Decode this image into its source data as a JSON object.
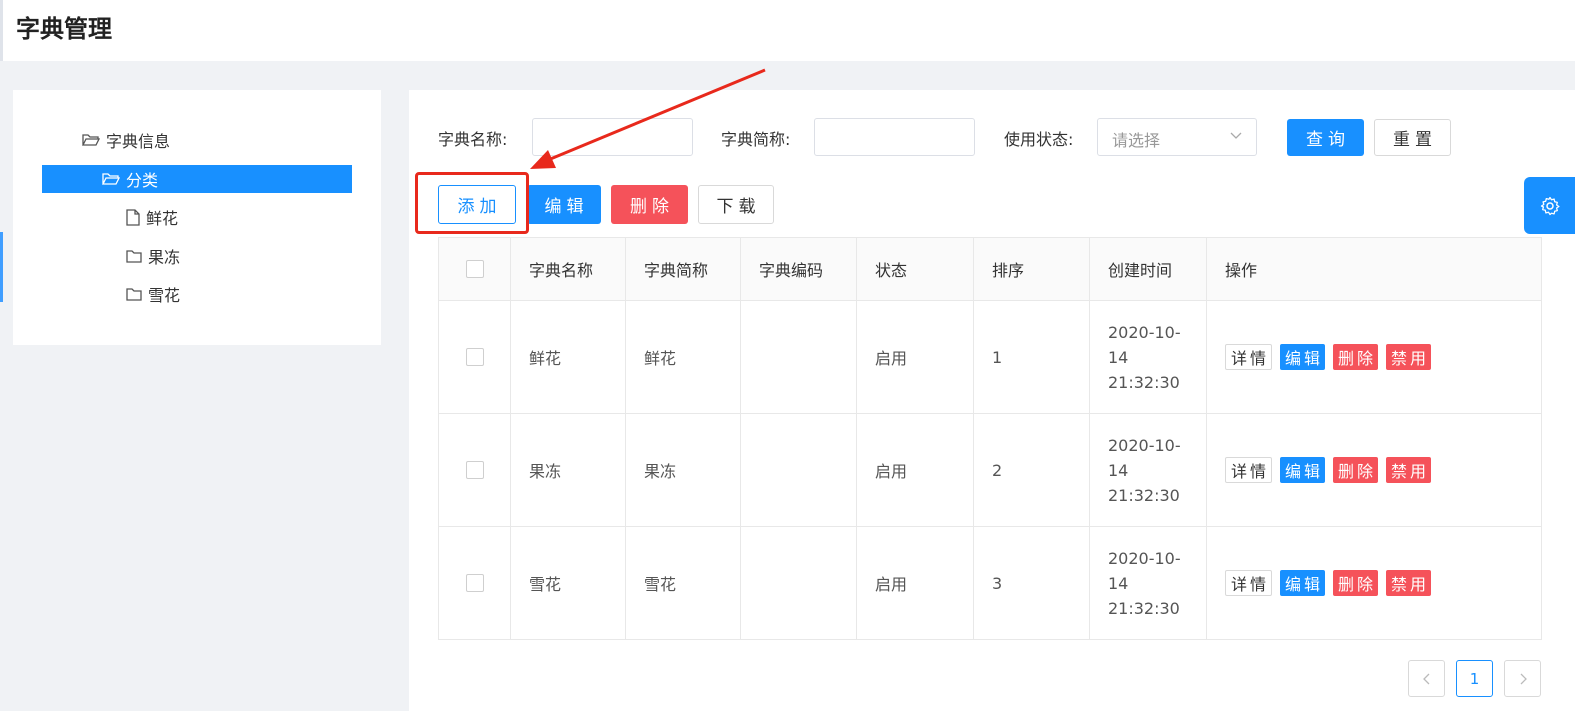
{
  "page": {
    "title": "字典管理"
  },
  "tree": {
    "root": {
      "label": "字典信息"
    },
    "selected": {
      "label": "分类"
    },
    "children": [
      {
        "label": "鲜花"
      },
      {
        "label": "果冻"
      },
      {
        "label": "雪花"
      }
    ]
  },
  "search": {
    "name_label": "字典名称:",
    "short_label": "字典简称:",
    "status_label": "使用状态:",
    "status_placeholder": "请选择",
    "query_button": "查询",
    "reset_button": "重置"
  },
  "toolbar": {
    "add": "添加",
    "edit": "编辑",
    "delete": "删除",
    "download": "下载"
  },
  "table": {
    "columns": [
      "字典名称",
      "字典简称",
      "字典编码",
      "状态",
      "排序",
      "创建时间",
      "操作"
    ],
    "rows": [
      {
        "name": "鲜花",
        "short": "鲜花",
        "code": "",
        "status": "启用",
        "order": "1",
        "time_date": "2020-10-",
        "time_day": "14",
        "time_clock": "21:32:30"
      },
      {
        "name": "果冻",
        "short": "果冻",
        "code": "",
        "status": "启用",
        "order": "2",
        "time_date": "2020-10-",
        "time_day": "14",
        "time_clock": "21:32:30"
      },
      {
        "name": "雪花",
        "short": "雪花",
        "code": "",
        "status": "启用",
        "order": "3",
        "time_date": "2020-10-",
        "time_day": "14",
        "time_clock": "21:32:30"
      }
    ],
    "ops": {
      "detail": "详情",
      "edit": "编辑",
      "delete": "删除",
      "disable": "禁用"
    }
  },
  "pagination": {
    "current": "1"
  },
  "colors": {
    "primary": "#1890ff",
    "danger": "#f5525a",
    "annotation": "#e8291c"
  }
}
